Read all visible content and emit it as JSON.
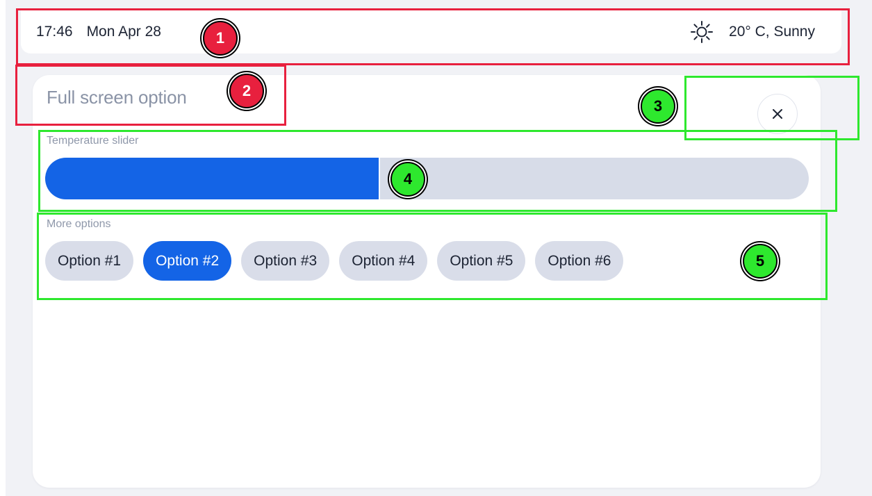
{
  "status_bar": {
    "time": "17:46",
    "date": "Mon Apr 28",
    "weather_icon": "sun-icon",
    "weather": "20° C, Sunny"
  },
  "panel": {
    "title": "Full screen option",
    "close_icon": "close-icon",
    "slider": {
      "label": "Temperature slider",
      "value_fraction": 0.437,
      "fill_color": "#1464e6",
      "track_color": "#d7dce8"
    },
    "options": {
      "label": "More options",
      "items": [
        "Option #1",
        "Option #2",
        "Option #3",
        "Option #4",
        "Option #5",
        "Option #6"
      ],
      "selected_index": 1,
      "selected_color": "#1464e6"
    }
  },
  "annotations": [
    {
      "number": "1",
      "color": "red"
    },
    {
      "number": "2",
      "color": "red"
    },
    {
      "number": "3",
      "color": "green"
    },
    {
      "number": "4",
      "color": "green"
    },
    {
      "number": "5",
      "color": "green"
    }
  ]
}
